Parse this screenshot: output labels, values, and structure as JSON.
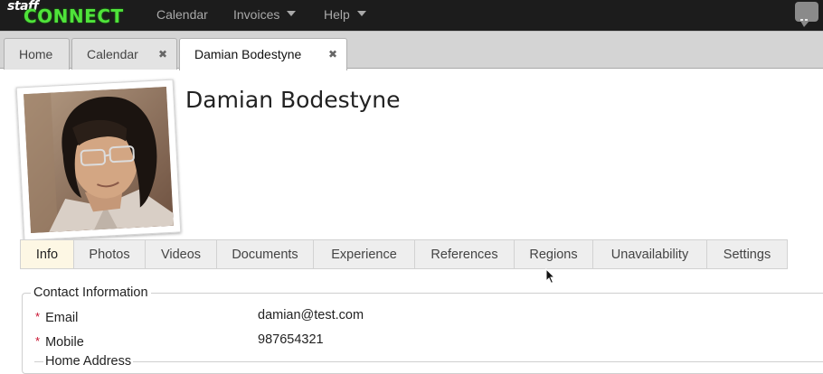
{
  "app": {
    "logo_top": "staff",
    "logo_bottom": "CONNECT"
  },
  "nav": {
    "items": [
      {
        "label": "Calendar",
        "has_caret": false
      },
      {
        "label": "Invoices",
        "has_caret": true
      },
      {
        "label": "Help",
        "has_caret": true
      }
    ],
    "chat_icon": "chat-bubble-icon"
  },
  "tabs": [
    {
      "label": "Home",
      "closable": false,
      "active": false
    },
    {
      "label": "Calendar",
      "closable": true,
      "active": false
    },
    {
      "label": "Damian Bodestyne",
      "closable": true,
      "active": true
    }
  ],
  "tab_close_glyph": "✖",
  "profile": {
    "name": "Damian Bodestyne",
    "photo_icon": "profile-photo"
  },
  "profile_tabs": [
    {
      "label": "Info",
      "active": true
    },
    {
      "label": "Photos",
      "active": false
    },
    {
      "label": "Videos",
      "active": false
    },
    {
      "label": "Documents",
      "active": false
    },
    {
      "label": "Experience",
      "active": false
    },
    {
      "label": "References",
      "active": false
    },
    {
      "label": "Regions",
      "active": false
    },
    {
      "label": "Unavailability",
      "active": false
    },
    {
      "label": "Settings",
      "active": false
    }
  ],
  "contact": {
    "legend": "Contact Information",
    "required_marker": "*",
    "fields": [
      {
        "label": "Email",
        "value": "damian@test.com"
      },
      {
        "label": "Mobile",
        "value": "987654321"
      }
    ],
    "sub_legend": "Home Address"
  },
  "colors": {
    "topbar": "#1c1c1c",
    "logo_green": "#4fe33a",
    "active_profile_tab": "#fdf7e4",
    "required_star": "#c8102e"
  }
}
